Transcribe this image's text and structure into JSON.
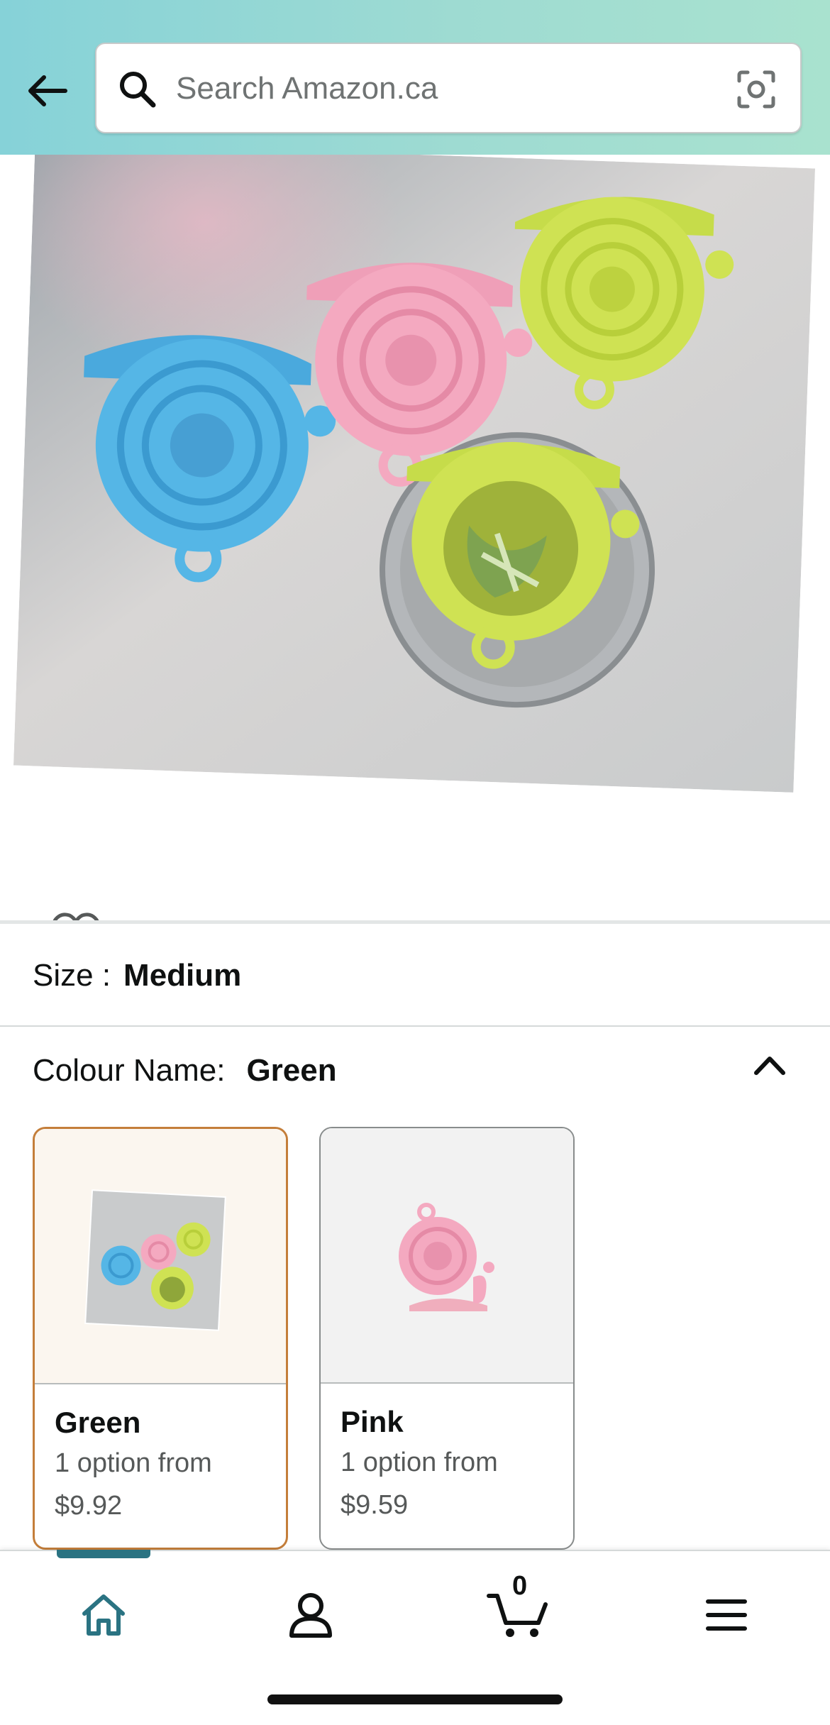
{
  "search": {
    "placeholder": "Search Amazon.ca"
  },
  "gallery": {
    "image_count": 7,
    "active_index": 0
  },
  "size": {
    "label": "Size :",
    "value": "Medium"
  },
  "colour": {
    "label": "Colour Name:",
    "value": "Green"
  },
  "swatches": [
    {
      "name": "Green",
      "options": "1 option from",
      "price": "$9.92",
      "selected": true
    },
    {
      "name": "Pink",
      "options": "1 option from",
      "price": "$9.59",
      "selected": false
    }
  ],
  "tabbar": {
    "cart_count": "0",
    "tabs": [
      "home-icon",
      "account-icon",
      "cart-icon",
      "menu-icon"
    ],
    "active": "home"
  },
  "colors": {
    "accent": "#2a7382",
    "selected_border": "#c47e3a",
    "header_start": "#86d2d8",
    "header_end": "#a9e2cf"
  }
}
